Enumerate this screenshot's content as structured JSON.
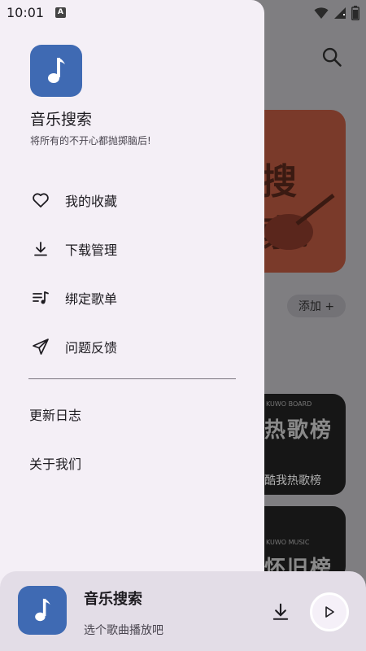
{
  "status_bar": {
    "time": "10:01",
    "notification_badge": "A",
    "icons": [
      "wifi-icon",
      "signal-icon",
      "battery-icon"
    ]
  },
  "drawer": {
    "app_title": "音乐搜索",
    "app_subtitle": "将所有的不开心都抛掷脑后!",
    "menu_items": [
      {
        "icon": "heart-icon",
        "label": "我的收藏"
      },
      {
        "icon": "download-icon",
        "label": "下载管理"
      },
      {
        "icon": "playlist-icon",
        "label": "绑定歌单"
      },
      {
        "icon": "send-icon",
        "label": "问题反馈"
      }
    ],
    "text_items": [
      {
        "label": "更新日志"
      },
      {
        "label": "关于我们"
      }
    ]
  },
  "background": {
    "banner_text": "搜索！",
    "add_button": "添加 +",
    "card1_tag": "KUWO BOARD",
    "card1_title": "热歌榜",
    "card1_subtitle": "酷我热歌榜",
    "card2_tag": "KUWO MUSIC",
    "card2_title": "怀旧榜"
  },
  "player": {
    "title": "音乐搜索",
    "subtitle": "选个歌曲播放吧"
  },
  "colors": {
    "accent": "#3f6ab3",
    "drawer_bg": "#f4eff6",
    "player_bg": "#e3dde7",
    "scrim": "#7f7e81"
  }
}
